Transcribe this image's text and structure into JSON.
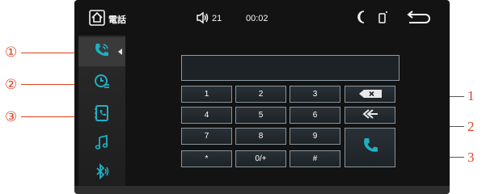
{
  "status_bar": {
    "home_icon": "home-icon",
    "title": "電話",
    "volume_icon": "volume-icon",
    "volume_level": "21",
    "clock": "00:02",
    "night_icon": "moon-icon",
    "phone_status_icon": "phone-signal-icon",
    "back_icon": "back-arrow-icon"
  },
  "sidebar": {
    "items": [
      {
        "name": "dialer",
        "icon": "phone-dial-icon",
        "active": true
      },
      {
        "name": "call-log",
        "icon": "call-history-icon",
        "active": false
      },
      {
        "name": "contacts",
        "icon": "contacts-book-icon",
        "active": false
      },
      {
        "name": "music",
        "icon": "music-note-icon",
        "active": false
      },
      {
        "name": "bluetooth",
        "icon": "bluetooth-audio-icon",
        "active": false
      }
    ]
  },
  "dialpad": {
    "display_value": "",
    "keys": [
      [
        "1",
        "2",
        "3"
      ],
      [
        "4",
        "5",
        "6"
      ],
      [
        "7",
        "8",
        "9"
      ],
      [
        "*",
        "0/+",
        "#"
      ]
    ],
    "function_keys": [
      "backspace-icon",
      "transfer-icon",
      "call-icon"
    ]
  },
  "annotations": {
    "left": [
      "①",
      "②",
      "③"
    ],
    "right": [
      "1",
      "2",
      "3"
    ]
  },
  "colors": {
    "accent": "#1fb0c4",
    "annotation_red": "#e0401e",
    "screen_bg": "#131313",
    "key_border": "#87959e"
  }
}
